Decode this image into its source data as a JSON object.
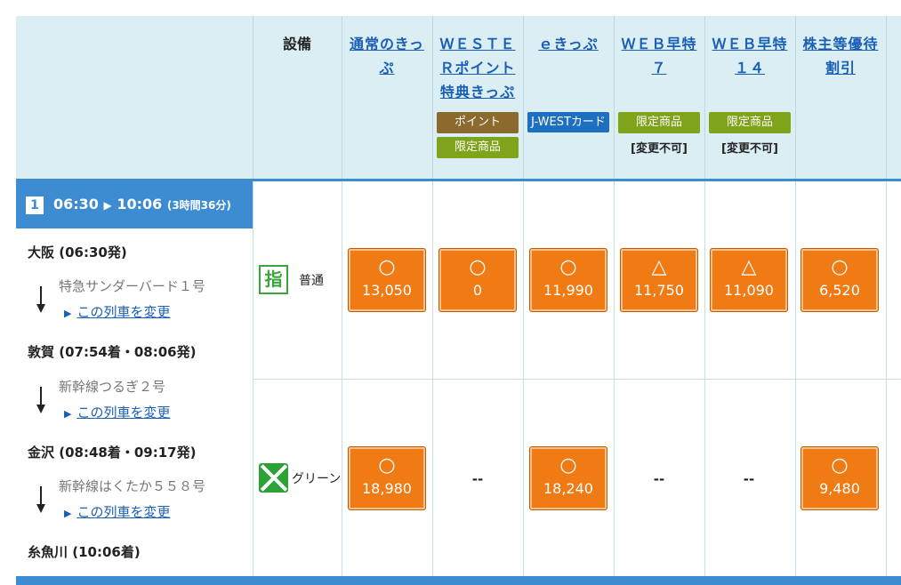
{
  "header": {
    "facility_label": "設備",
    "columns": [
      {
        "title": "通常のきっぷ",
        "tags": [],
        "note": ""
      },
      {
        "title": "ＷＥＳＴＥＲポイント特典きっぷ",
        "tags": [
          "ポイント",
          "限定商品"
        ],
        "note": ""
      },
      {
        "title": "ｅきっぷ",
        "tags": [
          "J-WESTカード"
        ],
        "note": ""
      },
      {
        "title": "ＷＥＢ早特７",
        "tags": [
          "限定商品"
        ],
        "note": "[変更不可]"
      },
      {
        "title": "ＷＥＢ早特１４",
        "tags": [
          "限定商品"
        ],
        "note": "[変更不可]"
      },
      {
        "title": "株主等優待割引",
        "tags": [],
        "note": ""
      }
    ]
  },
  "train": {
    "number": "1",
    "departure": "06:30",
    "arrival": "10:06",
    "duration": "(3時間36分)",
    "stops": [
      {
        "label": "大阪 (06:30発)"
      },
      {
        "label": "敦賀 (07:54着・08:06発)"
      },
      {
        "label": "金沢 (08:48着・09:17発)"
      },
      {
        "label": "糸魚川 (10:06着)"
      }
    ],
    "segments": [
      {
        "train_name": "特急サンダーバード１号",
        "change_label": "この列車を変更"
      },
      {
        "train_name": "新幹線つるぎ２号",
        "change_label": "この列車を変更"
      },
      {
        "train_name": "新幹線はくたか５５８号",
        "change_label": "この列車を変更"
      }
    ]
  },
  "seats": [
    {
      "icon": "reserved-seat-icon",
      "icon_glyph": "指",
      "label": "普通",
      "fares": [
        {
          "symbol": "○",
          "price": "13,050"
        },
        {
          "symbol": "○",
          "price": "0"
        },
        {
          "symbol": "○",
          "price": "11,990"
        },
        {
          "symbol": "△",
          "price": "11,750"
        },
        {
          "symbol": "△",
          "price": "11,090"
        },
        {
          "symbol": "○",
          "price": "6,520"
        }
      ]
    },
    {
      "icon": "green-car-icon",
      "label": "グリーン",
      "fares": [
        {
          "symbol": "○",
          "price": "18,980"
        },
        {
          "unavailable": "--"
        },
        {
          "symbol": "○",
          "price": "18,240"
        },
        {
          "unavailable": "--"
        },
        {
          "unavailable": "--"
        },
        {
          "symbol": "○",
          "price": "9,480"
        }
      ]
    }
  ],
  "colors": {
    "header_bg": "#daeef4",
    "accent_blue": "#3d8bd0",
    "fare_orange": "#f07a14",
    "tag_point": "#8c6a2e",
    "tag_limited": "#7fa31a",
    "tag_card": "#1d6fc1",
    "link": "#1a5fb4"
  }
}
